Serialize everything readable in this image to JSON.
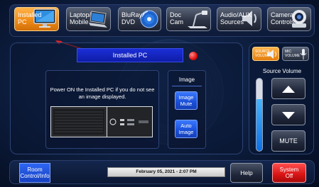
{
  "sources": [
    {
      "label": "Installed\nPC",
      "icon": "monitor-icon",
      "active": true
    },
    {
      "label": "Laptop/\nMobile",
      "icon": "laptop-icon",
      "active": false
    },
    {
      "label": "BluRay/\nDVD",
      "icon": "disc-icon",
      "active": false
    },
    {
      "label": "Doc\nCam",
      "icon": "document-camera-icon",
      "active": false
    },
    {
      "label": "Audio/AUX\nSources",
      "icon": "speaker-icon",
      "active": false
    },
    {
      "label": "Camera\nControls",
      "icon": "camera-icon",
      "active": false
    }
  ],
  "main": {
    "title": "Installed PC",
    "message": "Power ON the Installed PC if you do not see an image displayed."
  },
  "image_panel": {
    "heading": "Image",
    "mute_label": "Image\nMute",
    "auto_label": "Auto\nImage"
  },
  "volume": {
    "source_tab": "SOURCE\nVOLUME",
    "mic_tab": "MIC\nVOLUME",
    "label": "Source Volume",
    "level_percent": 72,
    "mute_label": "MUTE"
  },
  "bottom": {
    "room_label": "Room\nControl/Info",
    "datetime": "February 05, 2021  -  2:07 PM",
    "help_label": "Help",
    "off_label": "System\nOff"
  },
  "colors": {
    "active_orange": "#f08c17",
    "title_blue": "#1a2fd0",
    "status_red": "#e01010",
    "off_red": "#d81414"
  }
}
